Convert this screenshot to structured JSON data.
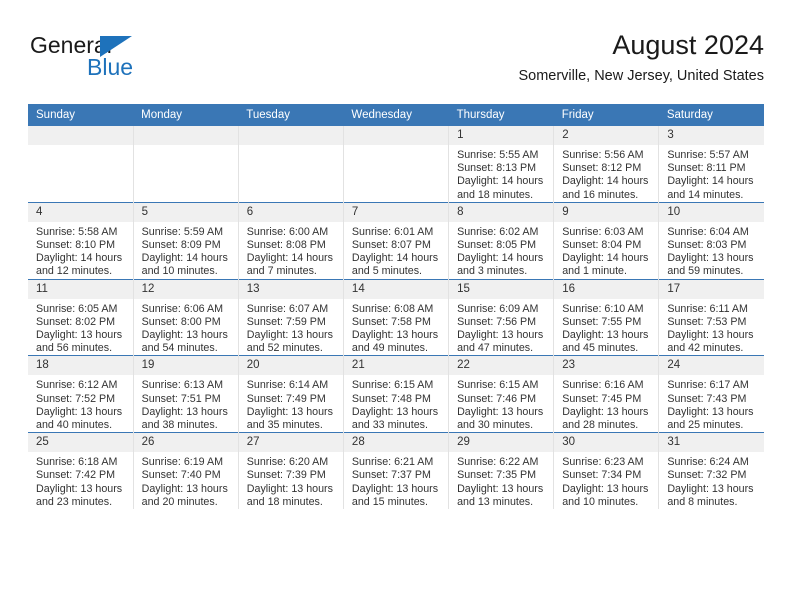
{
  "brand": {
    "name_top": "General",
    "name_bottom": "Blue",
    "accent_color": "#1e72bb"
  },
  "header": {
    "title": "August 2024",
    "subtitle": "Somerville, New Jersey, United States"
  },
  "theme": {
    "header_bg": "#3a77b5",
    "daynum_bg": "#f0f0f0",
    "text_color": "#333333"
  },
  "weekday_headers": [
    "Sunday",
    "Monday",
    "Tuesday",
    "Wednesday",
    "Thursday",
    "Friday",
    "Saturday"
  ],
  "weeks": [
    [
      {
        "day": "",
        "sunrise": "",
        "sunset": "",
        "daylight": "",
        "empty": true
      },
      {
        "day": "",
        "sunrise": "",
        "sunset": "",
        "daylight": "",
        "empty": true
      },
      {
        "day": "",
        "sunrise": "",
        "sunset": "",
        "daylight": "",
        "empty": true
      },
      {
        "day": "",
        "sunrise": "",
        "sunset": "",
        "daylight": "",
        "empty": true
      },
      {
        "day": "1",
        "sunrise": "Sunrise: 5:55 AM",
        "sunset": "Sunset: 8:13 PM",
        "daylight": "Daylight: 14 hours and 18 minutes."
      },
      {
        "day": "2",
        "sunrise": "Sunrise: 5:56 AM",
        "sunset": "Sunset: 8:12 PM",
        "daylight": "Daylight: 14 hours and 16 minutes."
      },
      {
        "day": "3",
        "sunrise": "Sunrise: 5:57 AM",
        "sunset": "Sunset: 8:11 PM",
        "daylight": "Daylight: 14 hours and 14 minutes."
      }
    ],
    [
      {
        "day": "4",
        "sunrise": "Sunrise: 5:58 AM",
        "sunset": "Sunset: 8:10 PM",
        "daylight": "Daylight: 14 hours and 12 minutes."
      },
      {
        "day": "5",
        "sunrise": "Sunrise: 5:59 AM",
        "sunset": "Sunset: 8:09 PM",
        "daylight": "Daylight: 14 hours and 10 minutes."
      },
      {
        "day": "6",
        "sunrise": "Sunrise: 6:00 AM",
        "sunset": "Sunset: 8:08 PM",
        "daylight": "Daylight: 14 hours and 7 minutes."
      },
      {
        "day": "7",
        "sunrise": "Sunrise: 6:01 AM",
        "sunset": "Sunset: 8:07 PM",
        "daylight": "Daylight: 14 hours and 5 minutes."
      },
      {
        "day": "8",
        "sunrise": "Sunrise: 6:02 AM",
        "sunset": "Sunset: 8:05 PM",
        "daylight": "Daylight: 14 hours and 3 minutes."
      },
      {
        "day": "9",
        "sunrise": "Sunrise: 6:03 AM",
        "sunset": "Sunset: 8:04 PM",
        "daylight": "Daylight: 14 hours and 1 minute."
      },
      {
        "day": "10",
        "sunrise": "Sunrise: 6:04 AM",
        "sunset": "Sunset: 8:03 PM",
        "daylight": "Daylight: 13 hours and 59 minutes."
      }
    ],
    [
      {
        "day": "11",
        "sunrise": "Sunrise: 6:05 AM",
        "sunset": "Sunset: 8:02 PM",
        "daylight": "Daylight: 13 hours and 56 minutes."
      },
      {
        "day": "12",
        "sunrise": "Sunrise: 6:06 AM",
        "sunset": "Sunset: 8:00 PM",
        "daylight": "Daylight: 13 hours and 54 minutes."
      },
      {
        "day": "13",
        "sunrise": "Sunrise: 6:07 AM",
        "sunset": "Sunset: 7:59 PM",
        "daylight": "Daylight: 13 hours and 52 minutes."
      },
      {
        "day": "14",
        "sunrise": "Sunrise: 6:08 AM",
        "sunset": "Sunset: 7:58 PM",
        "daylight": "Daylight: 13 hours and 49 minutes."
      },
      {
        "day": "15",
        "sunrise": "Sunrise: 6:09 AM",
        "sunset": "Sunset: 7:56 PM",
        "daylight": "Daylight: 13 hours and 47 minutes."
      },
      {
        "day": "16",
        "sunrise": "Sunrise: 6:10 AM",
        "sunset": "Sunset: 7:55 PM",
        "daylight": "Daylight: 13 hours and 45 minutes."
      },
      {
        "day": "17",
        "sunrise": "Sunrise: 6:11 AM",
        "sunset": "Sunset: 7:53 PM",
        "daylight": "Daylight: 13 hours and 42 minutes."
      }
    ],
    [
      {
        "day": "18",
        "sunrise": "Sunrise: 6:12 AM",
        "sunset": "Sunset: 7:52 PM",
        "daylight": "Daylight: 13 hours and 40 minutes."
      },
      {
        "day": "19",
        "sunrise": "Sunrise: 6:13 AM",
        "sunset": "Sunset: 7:51 PM",
        "daylight": "Daylight: 13 hours and 38 minutes."
      },
      {
        "day": "20",
        "sunrise": "Sunrise: 6:14 AM",
        "sunset": "Sunset: 7:49 PM",
        "daylight": "Daylight: 13 hours and 35 minutes."
      },
      {
        "day": "21",
        "sunrise": "Sunrise: 6:15 AM",
        "sunset": "Sunset: 7:48 PM",
        "daylight": "Daylight: 13 hours and 33 minutes."
      },
      {
        "day": "22",
        "sunrise": "Sunrise: 6:15 AM",
        "sunset": "Sunset: 7:46 PM",
        "daylight": "Daylight: 13 hours and 30 minutes."
      },
      {
        "day": "23",
        "sunrise": "Sunrise: 6:16 AM",
        "sunset": "Sunset: 7:45 PM",
        "daylight": "Daylight: 13 hours and 28 minutes."
      },
      {
        "day": "24",
        "sunrise": "Sunrise: 6:17 AM",
        "sunset": "Sunset: 7:43 PM",
        "daylight": "Daylight: 13 hours and 25 minutes."
      }
    ],
    [
      {
        "day": "25",
        "sunrise": "Sunrise: 6:18 AM",
        "sunset": "Sunset: 7:42 PM",
        "daylight": "Daylight: 13 hours and 23 minutes."
      },
      {
        "day": "26",
        "sunrise": "Sunrise: 6:19 AM",
        "sunset": "Sunset: 7:40 PM",
        "daylight": "Daylight: 13 hours and 20 minutes."
      },
      {
        "day": "27",
        "sunrise": "Sunrise: 6:20 AM",
        "sunset": "Sunset: 7:39 PM",
        "daylight": "Daylight: 13 hours and 18 minutes."
      },
      {
        "day": "28",
        "sunrise": "Sunrise: 6:21 AM",
        "sunset": "Sunset: 7:37 PM",
        "daylight": "Daylight: 13 hours and 15 minutes."
      },
      {
        "day": "29",
        "sunrise": "Sunrise: 6:22 AM",
        "sunset": "Sunset: 7:35 PM",
        "daylight": "Daylight: 13 hours and 13 minutes."
      },
      {
        "day": "30",
        "sunrise": "Sunrise: 6:23 AM",
        "sunset": "Sunset: 7:34 PM",
        "daylight": "Daylight: 13 hours and 10 minutes."
      },
      {
        "day": "31",
        "sunrise": "Sunrise: 6:24 AM",
        "sunset": "Sunset: 7:32 PM",
        "daylight": "Daylight: 13 hours and 8 minutes."
      }
    ]
  ]
}
